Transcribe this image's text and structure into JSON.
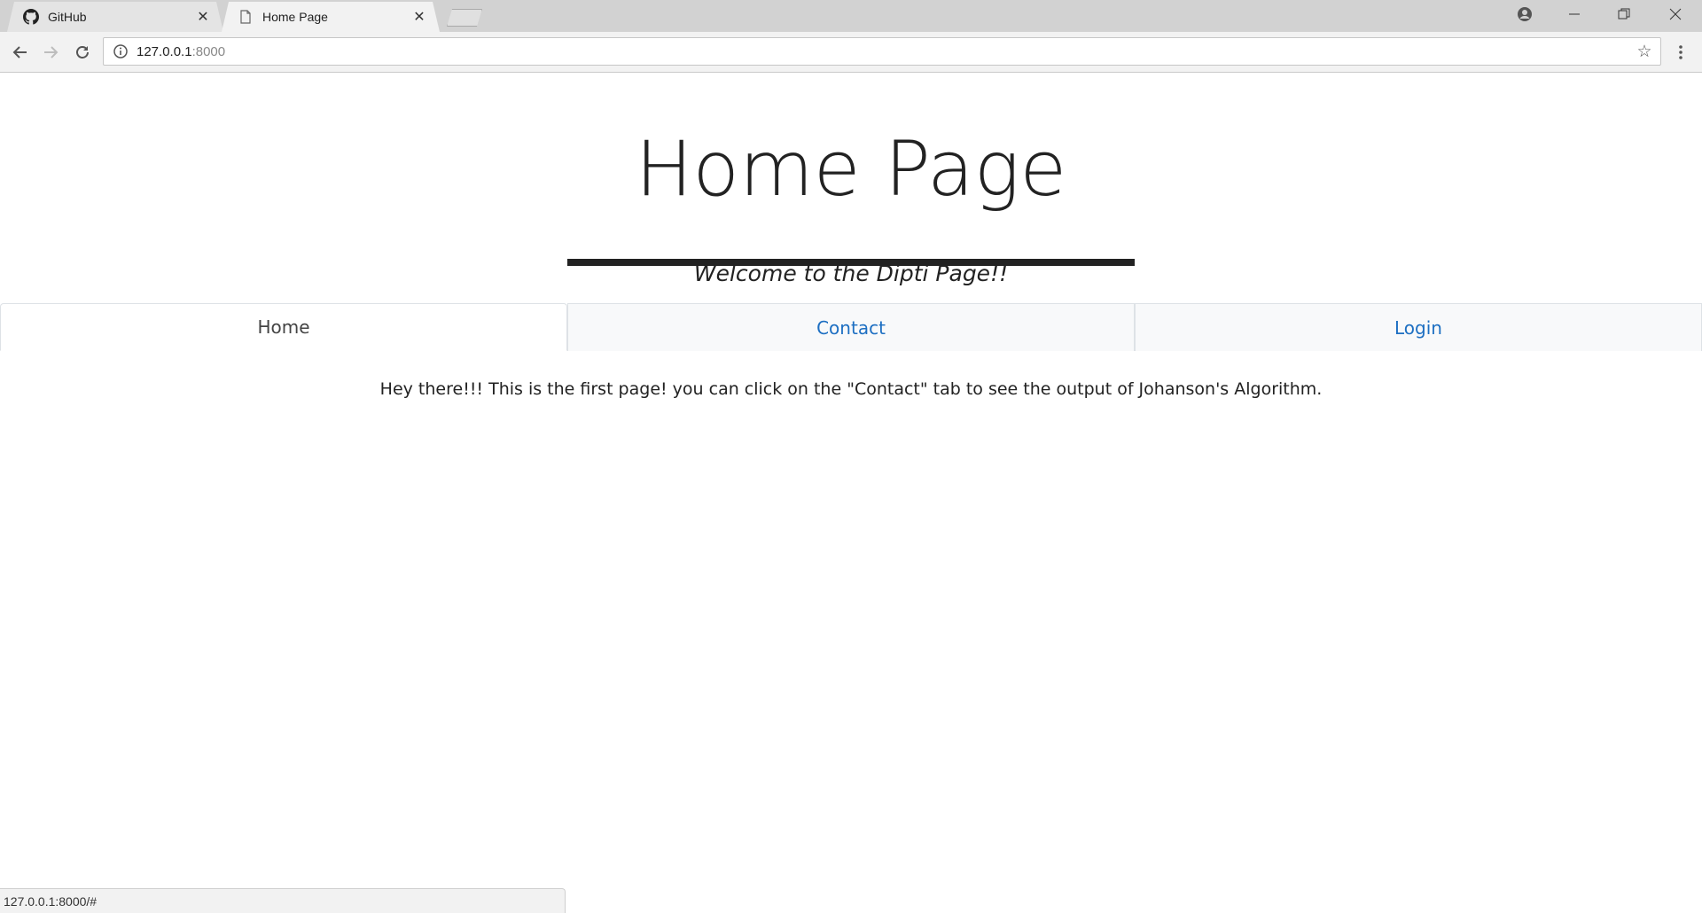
{
  "browser": {
    "tabs": [
      {
        "title": "GitHub",
        "icon": "github-icon",
        "active": false
      },
      {
        "title": "Home Page",
        "icon": "page-icon",
        "active": true
      }
    ],
    "url_host": "127.0.0.1",
    "url_rest": ":8000",
    "status_text": "127.0.0.1:8000/#"
  },
  "page": {
    "title": "Home Page",
    "subtitle": "Welcome to the Dipti Page!!",
    "nav": [
      {
        "label": "Home",
        "active": true
      },
      {
        "label": "Contact",
        "active": false
      },
      {
        "label": "Login",
        "active": false
      }
    ],
    "intro_text": "Hey there!!! This is the first page! you can click on the \"Contact\" tab to see the output of Johanson's Algorithm."
  },
  "colors": {
    "link": "#1d6fc2",
    "text": "#222222",
    "tab_bg": "#f8f9fa",
    "chrome_bg": "#d2d2d2"
  }
}
